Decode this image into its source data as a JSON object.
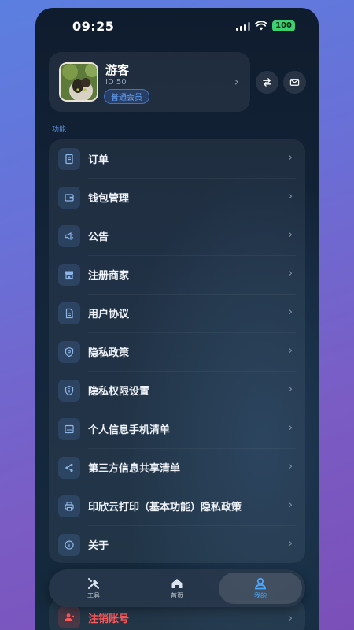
{
  "status_bar": {
    "time": "09:25",
    "battery": "100"
  },
  "profile": {
    "name": "游客",
    "id": "ID 50",
    "badge": "普通会员"
  },
  "section_title": "功能",
  "menu": [
    {
      "label": "订单",
      "icon": "order-icon"
    },
    {
      "label": "钱包管理",
      "icon": "wallet-icon"
    },
    {
      "label": "公告",
      "icon": "megaphone-icon"
    },
    {
      "label": "注册商家",
      "icon": "store-icon"
    },
    {
      "label": "用户协议",
      "icon": "document-icon"
    },
    {
      "label": "隐私政策",
      "icon": "shield-icon"
    },
    {
      "label": "隐私权限设置",
      "icon": "info-icon"
    },
    {
      "label": "个人信息手机清单",
      "icon": "list-card-icon"
    },
    {
      "label": "第三方信息共享清单",
      "icon": "share-icon"
    },
    {
      "label": "印欣云打印（基本功能）隐私政策",
      "icon": "printer-icon"
    },
    {
      "label": "关于",
      "icon": "info-icon"
    }
  ],
  "logout": {
    "label": "注销账号"
  },
  "tabbar": {
    "tabs": [
      {
        "label": "工具",
        "icon": "tools-icon"
      },
      {
        "label": "首页",
        "icon": "home-icon"
      },
      {
        "label": "我的",
        "icon": "user-icon"
      }
    ],
    "active": "我的"
  },
  "colors": {
    "accent": "#4aa8ff",
    "danger": "#ff5a5a",
    "battery": "#3cd070"
  }
}
